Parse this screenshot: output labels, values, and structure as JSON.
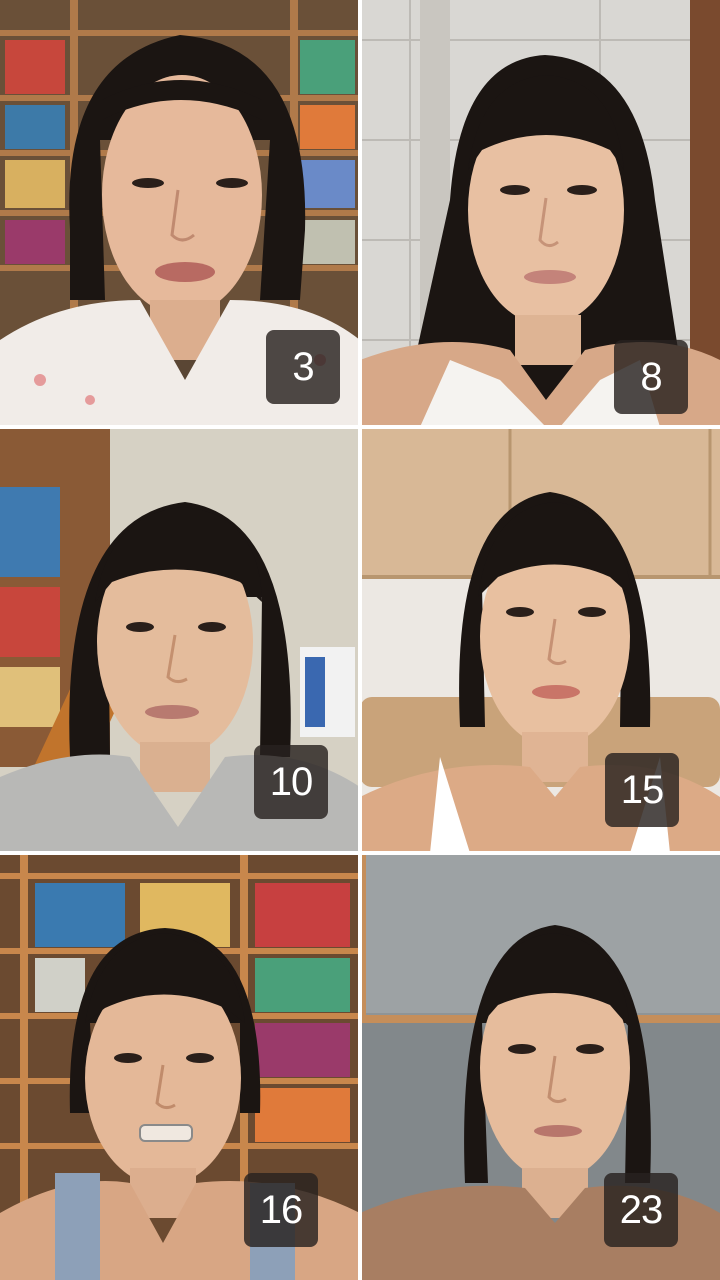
{
  "photos": [
    {
      "label": "3",
      "background": "bookshelf",
      "clothing": "white-floral-pajamas"
    },
    {
      "label": "8",
      "background": "white-tile-wall",
      "clothing": "white-tank-top"
    },
    {
      "label": "10",
      "background": "bookshelf-stairs",
      "clothing": "grey-tshirt"
    },
    {
      "label": "15",
      "background": "wood-cabinets-sofa",
      "clothing": "white-camisole"
    },
    {
      "label": "16",
      "background": "bookshelf",
      "clothing": "denim-overalls"
    },
    {
      "label": "23",
      "background": "grey-wall-wood-trim",
      "clothing": "brown-top"
    }
  ],
  "colors": {
    "skin": "#e8bf9f",
    "hair": "#1b1512",
    "badge": "#2a2320",
    "badge_text": "#ffffff"
  }
}
